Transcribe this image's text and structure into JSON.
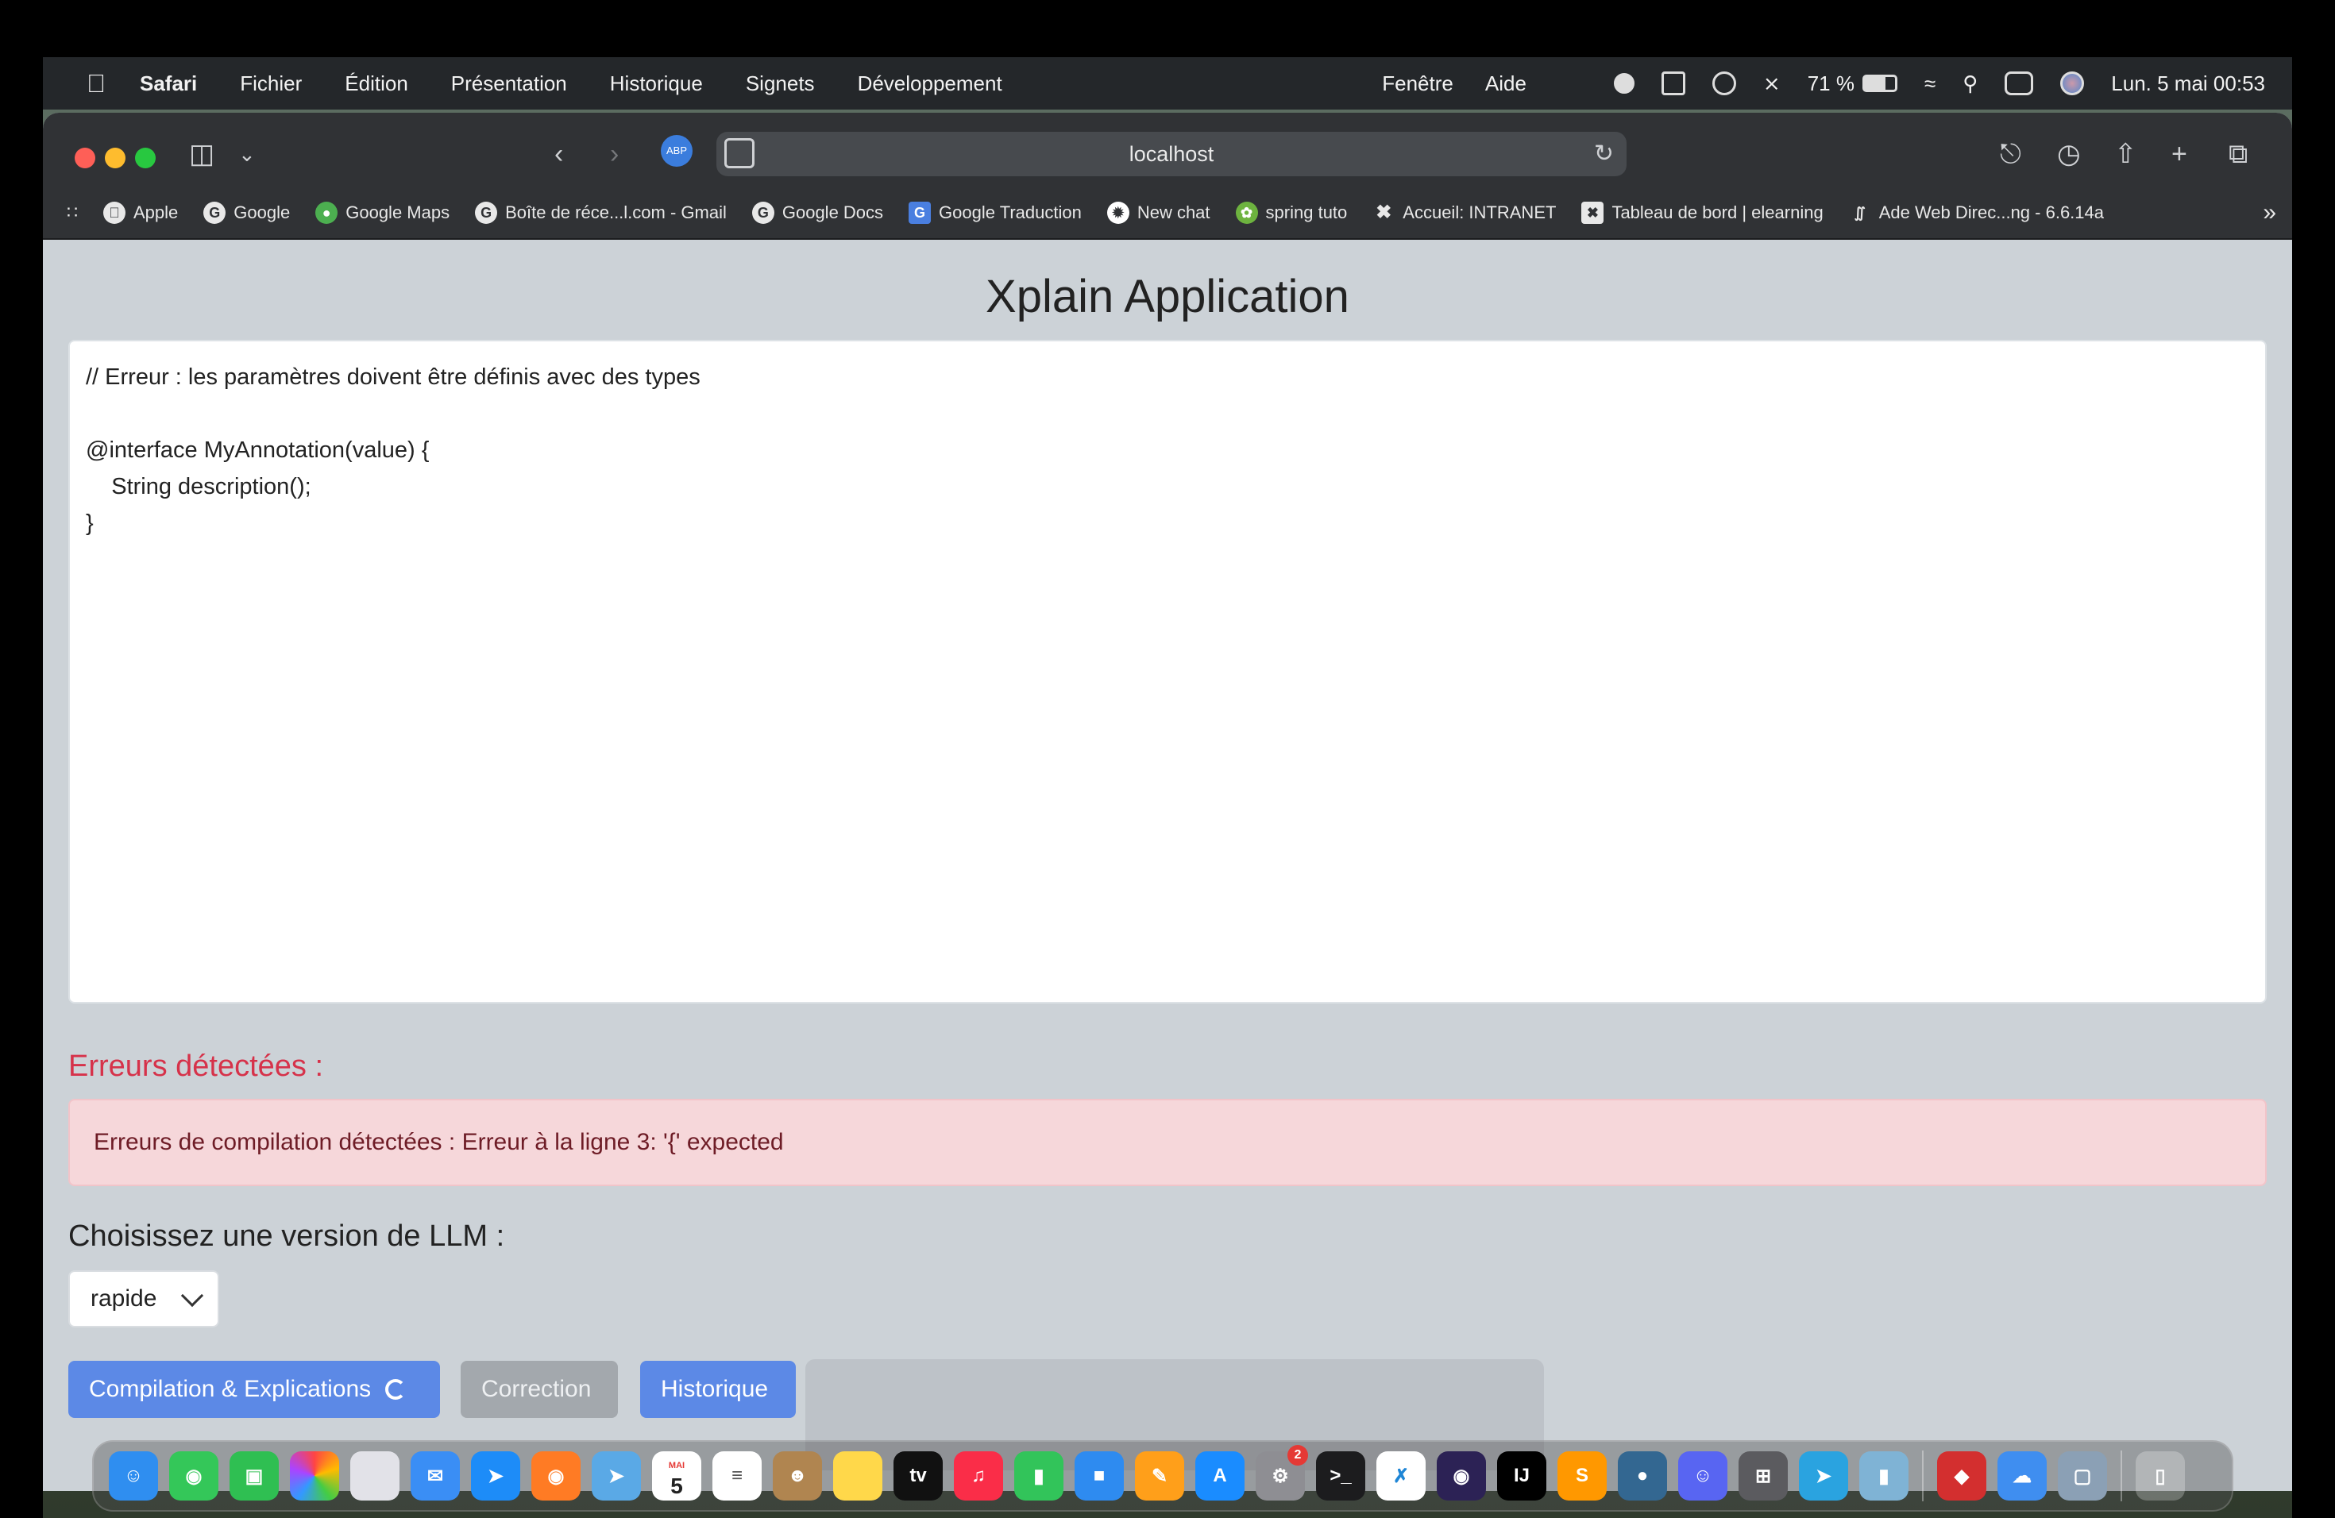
{
  "menubar": {
    "app": "Safari",
    "items": [
      "Fichier",
      "Édition",
      "Présentation",
      "Historique",
      "Signets",
      "Développement"
    ],
    "right_items": [
      "Fenêtre",
      "Aide"
    ],
    "battery": "71 %",
    "datetime": "Lun. 5 mai  00:53"
  },
  "browser": {
    "url": "localhost",
    "bookmarks": [
      {
        "label": "Apple",
        "icon": "apple-icon"
      },
      {
        "label": "Google",
        "icon": "google-icon"
      },
      {
        "label": "Google Maps",
        "icon": "maps-pin-icon"
      },
      {
        "label": "Boîte de réce...l.com - Gmail",
        "icon": "google-icon"
      },
      {
        "label": "Google Docs",
        "icon": "google-icon"
      },
      {
        "label": "Google Traduction",
        "icon": "translate-icon"
      },
      {
        "label": "New chat",
        "icon": "chatgpt-icon"
      },
      {
        "label": "spring tuto",
        "icon": "spring-icon"
      },
      {
        "label": "Accueil: INTRANET",
        "icon": "intranet-icon"
      },
      {
        "label": "Tableau de bord | elearning",
        "icon": "elearning-icon"
      },
      {
        "label": "Ade Web Direc...ng - 6.6.14a",
        "icon": "ade-icon"
      }
    ]
  },
  "page": {
    "title": "Xplain Application",
    "code": "// Erreur : les paramètres doivent être définis avec des types\n\n@interface MyAnnotation(value) {\n    String description();\n}",
    "errors_heading": "Erreurs détectées :",
    "error_message": "Erreurs de compilation détectées : Erreur à la ligne 3: '{' expected",
    "llm_label": "Choisissez une version de LLM :",
    "llm_selected": "rapide",
    "buttons": {
      "compile": "Compilation & Explications",
      "correction": "Correction",
      "historique": "Historique"
    }
  },
  "dock": {
    "badge_settings": "2",
    "calendar_day": "5",
    "calendar_month": "MAI"
  },
  "colors": {
    "primary": "#5c89e6",
    "secondary": "#a3a8ad",
    "error_text": "#d6324a",
    "error_bg": "#f6d7da",
    "page_bg": "#ccd2d7"
  }
}
